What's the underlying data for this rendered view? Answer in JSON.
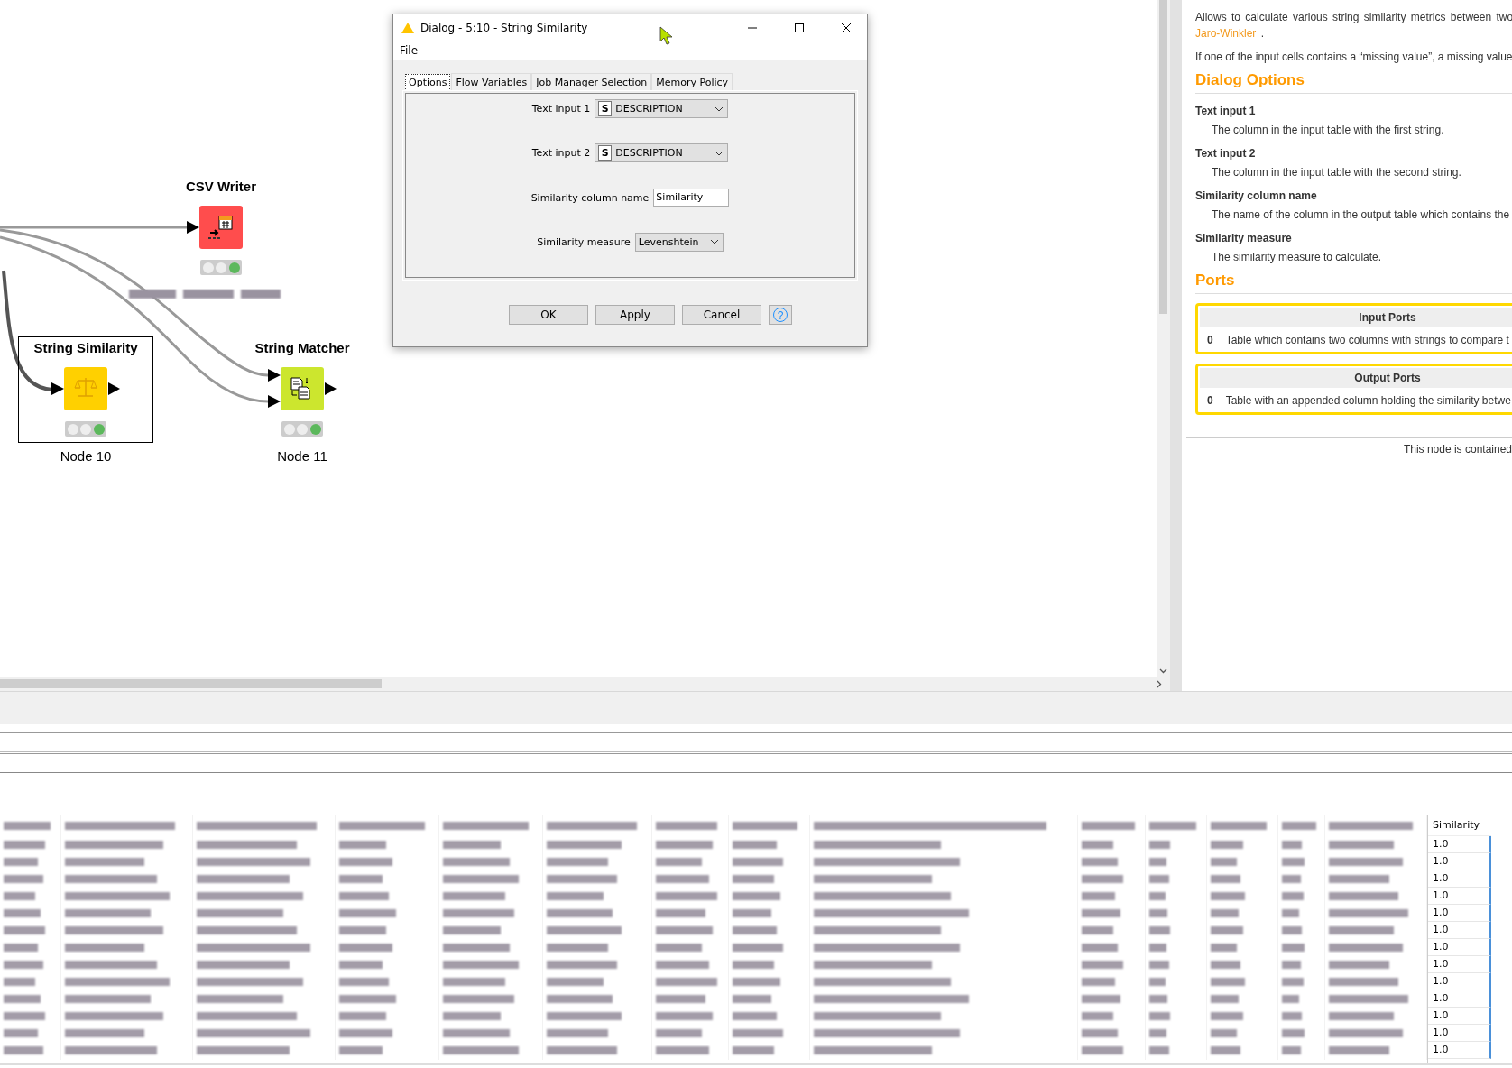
{
  "workflow": {
    "nodes": [
      {
        "title": "CSV Writer",
        "kind": "writer",
        "color": "#ff4d4d",
        "lamps": [
          {
            "on": false
          },
          {
            "on": false
          },
          {
            "on": true
          }
        ],
        "selected": false,
        "annotation_blurred": true
      },
      {
        "title": "String Similarity",
        "kind": "similarity",
        "color": "#ffd000",
        "lamps": [
          {
            "on": false
          },
          {
            "on": false
          },
          {
            "on": true
          }
        ],
        "selected": true,
        "annotation": "Node 10"
      },
      {
        "title": "String Matcher",
        "kind": "matcher",
        "color": "#cce62e",
        "lamps": [
          {
            "on": false
          },
          {
            "on": false
          },
          {
            "on": true
          }
        ],
        "selected": false,
        "annotation": "Node 11"
      }
    ]
  },
  "dialog": {
    "title": "Dialog - 5:10 - String Similarity",
    "menu": [
      "File"
    ],
    "tabs": [
      {
        "label": "Options",
        "selected": true
      },
      {
        "label": "Flow Variables",
        "selected": false
      },
      {
        "label": "Job Manager Selection",
        "selected": false
      },
      {
        "label": "Memory Policy",
        "selected": false
      }
    ],
    "fields": [
      {
        "kind": "column-select",
        "label": "Text input 1",
        "type_badge": "S",
        "value": "DESCRIPTION"
      },
      {
        "kind": "column-select",
        "label": "Text input 2",
        "type_badge": "S",
        "value": "DESCRIPTION"
      },
      {
        "kind": "text",
        "label": "Similarity column name",
        "value": "Similarity"
      },
      {
        "kind": "select",
        "label": "Similarity measure",
        "value": "Levenshtein"
      }
    ],
    "buttons": [
      "OK",
      "Apply",
      "Cancel"
    ],
    "help_label": "?"
  },
  "description": {
    "intro": {
      "text": "Allows to calculate various string similarity metrics between two",
      "link": "Jaro-Winkler",
      "after": " ."
    },
    "note": "If one of the input cells contains a “missing value”, a missing value",
    "options_heading": "Dialog Options",
    "options": [
      {
        "name": "Text input 1",
        "description": "The column in the input table with the first string."
      },
      {
        "name": "Text input 2",
        "description": "The column in the input table with the second string."
      },
      {
        "name": "Similarity column name",
        "description": "The name of the column in the output table which contains the"
      },
      {
        "name": "Similarity measure",
        "description": "The similarity measure to calculate."
      }
    ],
    "ports_heading": "Ports",
    "ports": [
      {
        "title": "Input Ports",
        "index": "0",
        "description": "Table which contains two columns with strings to compare t"
      },
      {
        "title": "Output Ports",
        "index": "0",
        "description": "Table with an appended column holding the similarity betwe"
      }
    ],
    "footer": "This node is contained"
  },
  "table": {
    "columns": [
      {
        "kind": "blurred"
      },
      {
        "kind": "blurred"
      },
      {
        "kind": "blurred"
      },
      {
        "kind": "blurred"
      },
      {
        "kind": "blurred"
      },
      {
        "kind": "blurred"
      },
      {
        "kind": "blurred"
      },
      {
        "kind": "blurred"
      },
      {
        "kind": "blurred"
      },
      {
        "kind": "blurred"
      },
      {
        "kind": "blurred"
      },
      {
        "kind": "blurred"
      },
      {
        "kind": "blurred"
      },
      {
        "kind": "blurred"
      },
      {
        "kind": "text",
        "header": "Similarity"
      }
    ],
    "rows": [
      {
        "similarity": "1.0"
      },
      {
        "similarity": "1.0"
      },
      {
        "similarity": "1.0"
      },
      {
        "similarity": "1.0"
      },
      {
        "similarity": "1.0"
      },
      {
        "similarity": "1.0"
      },
      {
        "similarity": "1.0"
      },
      {
        "similarity": "1.0"
      },
      {
        "similarity": "1.0"
      },
      {
        "similarity": "1.0"
      },
      {
        "similarity": "1.0"
      },
      {
        "similarity": "1.0"
      },
      {
        "similarity": "1.0"
      }
    ]
  }
}
